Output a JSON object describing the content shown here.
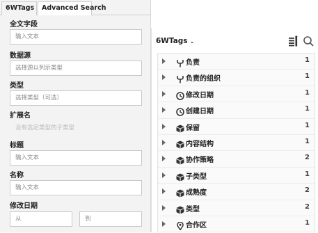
{
  "left_panel": {
    "tabs": [
      {
        "label": "6WTags",
        "caret": "⌄"
      },
      {
        "label": "Advanced Search"
      }
    ],
    "fields": [
      {
        "label": "全文字段",
        "placeholder": "输入文本"
      },
      {
        "label": "数据源",
        "placeholder": "选择源以列示类型"
      },
      {
        "label": "类型",
        "placeholder": "选择类型（可选）"
      },
      {
        "label": "扩展名",
        "placeholder": "没有选定类型的子类型"
      },
      {
        "label": "标题",
        "placeholder": "输入文本"
      },
      {
        "label": "名称",
        "placeholder": "输入文本"
      },
      {
        "label": "修改日期",
        "from_placeholder": "从",
        "to_placeholder": "到"
      }
    ]
  },
  "right_panel": {
    "title": "6WTags",
    "caret": "⌄",
    "icons": [
      "list-icon",
      "search-icon"
    ],
    "items": [
      {
        "label": "负责",
        "count": "1",
        "icon": "fork-icon"
      },
      {
        "label": "负责的组织",
        "count": "1",
        "icon": "fork-icon"
      },
      {
        "label": "修改日期",
        "count": "1",
        "icon": "clock-icon"
      },
      {
        "label": "创建日期",
        "count": "1",
        "icon": "clock-icon"
      },
      {
        "label": "保留",
        "count": "1",
        "icon": "cube-icon"
      },
      {
        "label": "内容结构",
        "count": "1",
        "icon": "cube-icon"
      },
      {
        "label": "协作策略",
        "count": "2",
        "icon": "cube-icon"
      },
      {
        "label": "子类型",
        "count": "1",
        "icon": "cube-icon"
      },
      {
        "label": "成熟度",
        "count": "2",
        "icon": "cube-icon"
      },
      {
        "label": "类型",
        "count": "2",
        "icon": "cube-icon"
      },
      {
        "label": "合作区",
        "count": "1",
        "icon": "pin-icon"
      }
    ]
  }
}
